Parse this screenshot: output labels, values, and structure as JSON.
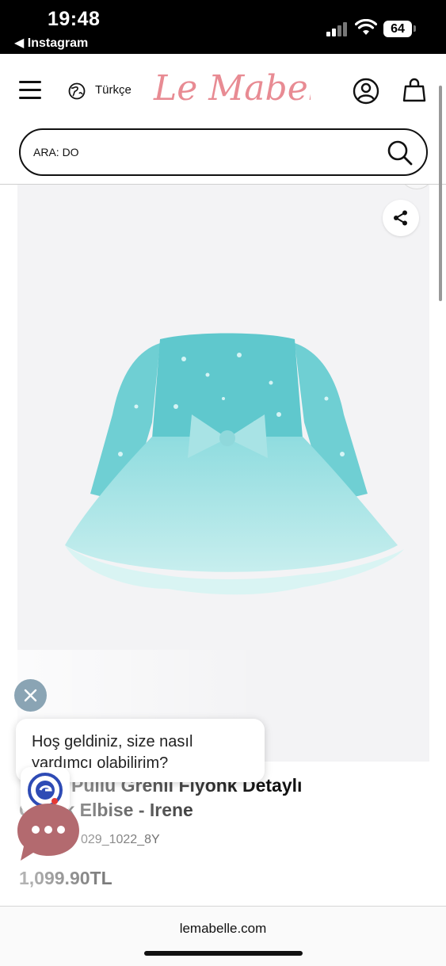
{
  "status_bar": {
    "time": "19:48",
    "back_app": "◀ Instagram",
    "battery": "64"
  },
  "header": {
    "language": "Türkçe",
    "logo_text": "Le Mabelle",
    "brand_color": "#e88b93"
  },
  "search": {
    "value": "ARA: DO"
  },
  "product": {
    "title_line1": "Pullu Grenli Fiyonk Detaylı",
    "title_line2": "Çocuk Elbise - Irene",
    "sku": "029_1022_8Y",
    "price": "1,099.90TL",
    "dress_color": "#7fd6d8"
  },
  "chat": {
    "greeting_line1": "Hoş geldiniz, size nasıl",
    "greeting_line2": "yardımcı olabilirim?",
    "launcher_color": "#b36a6f"
  },
  "browser": {
    "url": "lemabelle.com"
  }
}
